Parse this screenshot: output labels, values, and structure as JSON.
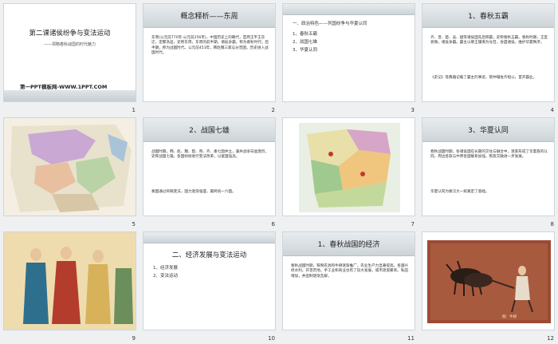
{
  "slides": [
    {
      "number": "1",
      "title": "第二课诸侯纷争与变法运动",
      "subtitle": "——领略春秋战国的时代魅力",
      "footer": "第一PPT模板网-WWW.1PPT.COM"
    },
    {
      "number": "2",
      "title": "概念释析——东周",
      "body": "东周(公元前770年-公元前256年)，中国历史上的朝代，首周王平王东迁，定都洛邑，史称东周，东周的前半期，诸侯争霸，称为春秋时代；后半期，称为战国时代。公元前453年，韩赵魏三家瓜分晋国，历史进入战国时代。"
    },
    {
      "number": "3",
      "heading": "一、政治特色——列国纷争与华夏认同",
      "items": [
        "1、春秋五霸",
        "2、战国七雄",
        "3、华夏认同"
      ]
    },
    {
      "number": "4",
      "title": "1、春秋五霸",
      "body": "齐、晋、楚、吴、越等诸侯国先后称霸，史称春秋五霸。春秋时期，王室衰微，诸侯争霸。霸主以尊王攘夷为号召，会盟诸侯，维护华夏秩序。",
      "body2": "《史记》等典籍记载了霸主的事迹，管仲辅佐齐桓公，首开霸业。"
    },
    {
      "number": "5"
    },
    {
      "number": "6",
      "title": "2、战国七雄",
      "body": "战国时期，韩、赵、魏、楚、燕、齐、秦七国并立，兼并战争日益激烈，史称战国七雄。各国纷纷进行变法改革，以富国强兵。",
      "body2": "秦国通过商鞅变法，国力逐渐强盛，最终统一六国。"
    },
    {
      "number": "7"
    },
    {
      "number": "8",
      "title": "3、华夏认同",
      "body": "春秋战国时期，各诸侯国在长期的交往与融合中，逐渐形成了华夏族的认同。周边各族与中原各国联系加强，民族交融进一步发展。",
      "body2": "华夏认同为秦汉大一统奠定了基础。"
    },
    {
      "number": "9"
    },
    {
      "number": "10",
      "title": "二、经济发展与变法运动",
      "items": [
        "1、经济发展",
        "2、变法运动"
      ]
    },
    {
      "number": "11",
      "title": "1、春秋战国的经济",
      "body": "春秋战国时期，铁制农具和牛耕逐渐推广，农业生产力显著提高。各国兴修水利，开垦荒地，手工业和商业也有了较大发展，城市逐渐繁荣。私田增加，井田制逐渐瓦解。"
    },
    {
      "number": "12",
      "caption": "图：牛耕"
    }
  ]
}
